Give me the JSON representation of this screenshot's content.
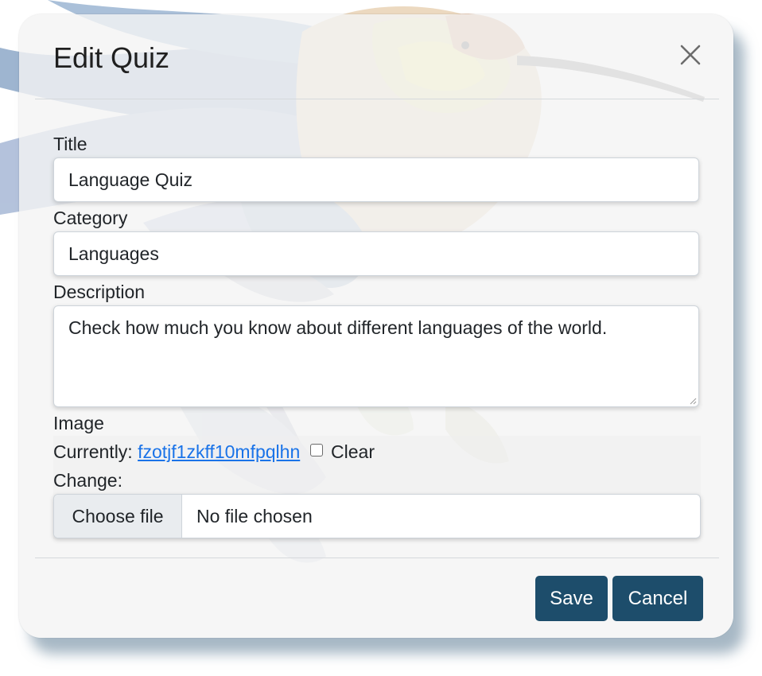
{
  "dialog": {
    "title": "Edit Quiz"
  },
  "form": {
    "title": {
      "label": "Title",
      "value": "Language Quiz"
    },
    "category": {
      "label": "Category",
      "value": "Languages"
    },
    "description": {
      "label": "Description",
      "value": "Check how much you know about different languages of the world."
    },
    "image": {
      "label": "Image",
      "currently_label": "Currently:",
      "current_file": "fzotjf1zkff10mfpqlhn",
      "clear_label": "Clear",
      "change_label": "Change:",
      "choose_file_label": "Choose file",
      "file_status": "No file chosen"
    }
  },
  "footer": {
    "save_label": "Save",
    "cancel_label": "Cancel"
  },
  "icons": {
    "close": "close-icon"
  },
  "colors": {
    "primary_button": "#1d4d6b",
    "link": "#1a73e8",
    "dialog_background": "#f4f4f4"
  }
}
